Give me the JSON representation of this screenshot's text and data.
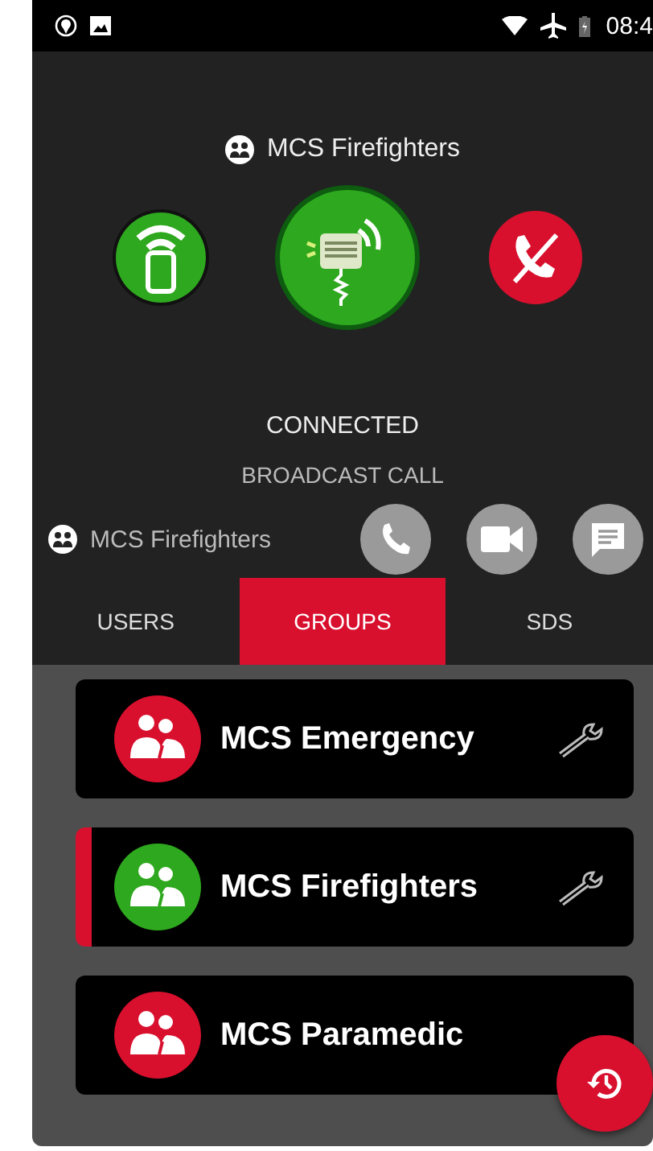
{
  "status_bar": {
    "time": "08:4"
  },
  "call": {
    "group": "MCS Firefighters",
    "status": "CONNECTED",
    "call_type": "BROADCAST CALL"
  },
  "active_group": {
    "name": "MCS Firefighters"
  },
  "tabs": [
    {
      "label": "USERS",
      "selected": false
    },
    {
      "label": "GROUPS",
      "selected": true
    },
    {
      "label": "SDS",
      "selected": false
    }
  ],
  "groups": [
    {
      "name": "MCS Emergency",
      "color": "#d8102e",
      "selected": false
    },
    {
      "name": "MCS Firefighters",
      "color": "#2ea81e",
      "selected": true
    },
    {
      "name": "MCS Paramedic",
      "color": "#d8102e",
      "selected": false
    }
  ]
}
